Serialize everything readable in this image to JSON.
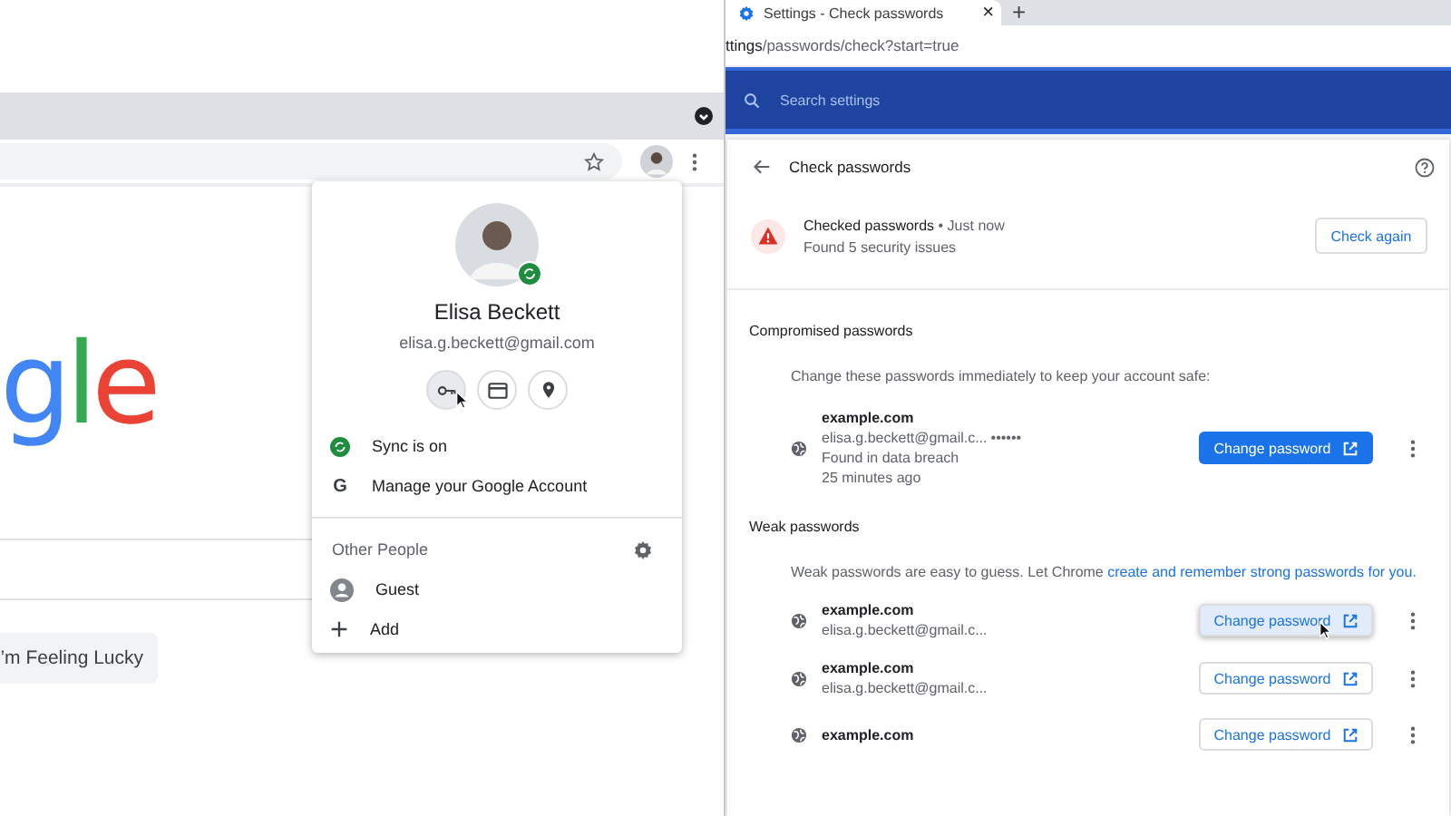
{
  "left_window": {
    "logo_letters": [
      {
        "text": "g",
        "color": "#4285f4"
      },
      {
        "text": "l",
        "color": "#34a853"
      },
      {
        "text": "e",
        "color": "#ea4335"
      }
    ],
    "lucky_button": "’m Feeling Lucky"
  },
  "profile_menu": {
    "name": "Elisa Beckett",
    "email": "elisa.g.beckett@gmail.com",
    "shortcuts": [
      {
        "kind": "key",
        "selected": true
      },
      {
        "kind": "card",
        "selected": false
      },
      {
        "kind": "pin",
        "selected": false
      }
    ],
    "items": [
      {
        "kind": "sync",
        "label": "Sync is on"
      },
      {
        "kind": "google",
        "label": "Manage your Google Account",
        "icon_text": "G"
      }
    ],
    "other_people_title": "Other People",
    "people": [
      {
        "kind": "guest",
        "label": "Guest"
      },
      {
        "kind": "add",
        "label": "Add"
      }
    ]
  },
  "right_window": {
    "tab": {
      "title": "Settings - Check passwords",
      "close": "×"
    },
    "new_tab": "+",
    "url_bold": "ttings",
    "url_rest": "/passwords/check?start=true",
    "search": {
      "placeholder": "Search settings"
    },
    "page_title": "Check passwords",
    "status": {
      "title": "Checked passwords",
      "time": "• Just now",
      "subtitle": "Found 5 security issues",
      "button": "Check again"
    },
    "compromised": {
      "heading": "Compromised passwords",
      "description": "Change these passwords immediately to keep your account safe:",
      "items": [
        {
          "site": "example.com",
          "user": "elisa.g.beckett@gmail.c...",
          "masked": "••••••",
          "lines": [
            "Found in data breach",
            "25 minutes ago"
          ],
          "button": "Change password"
        }
      ]
    },
    "weak": {
      "heading": "Weak passwords",
      "description": "Weak passwords are easy to guess. Let Chrome ",
      "link": "create and remember strong passwords for you.",
      "items": [
        {
          "site": "example.com",
          "user": "elisa.g.beckett@gmail.c...",
          "button": "Change password",
          "hovered": true
        },
        {
          "site": "example.com",
          "user": "elisa.g.beckett@gmail.c...",
          "button": "Change password",
          "hovered": false
        },
        {
          "site": "example.com",
          "button": "Change password",
          "hovered": false
        }
      ]
    }
  }
}
